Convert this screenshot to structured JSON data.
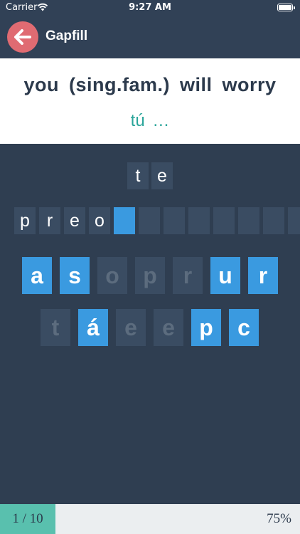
{
  "status": {
    "carrier": "Carrier",
    "time": "9:27 AM"
  },
  "nav": {
    "title": "Gapfill"
  },
  "prompt": {
    "english": "you (sing.fam.) will worry",
    "hint": "tú …"
  },
  "answer_prefix": [
    "t",
    "e"
  ],
  "word_slots": [
    "p",
    "r",
    "e",
    "o",
    "",
    "",
    "",
    "",
    "",
    "",
    "",
    ""
  ],
  "active_slot": 4,
  "keyboard": {
    "row1": [
      {
        "letter": "a",
        "available": true
      },
      {
        "letter": "s",
        "available": true
      },
      {
        "letter": "o",
        "available": false
      },
      {
        "letter": "p",
        "available": false
      },
      {
        "letter": "r",
        "available": false
      },
      {
        "letter": "u",
        "available": true
      },
      {
        "letter": "r",
        "available": true
      }
    ],
    "row2": [
      {
        "letter": "t",
        "available": false
      },
      {
        "letter": "á",
        "available": true
      },
      {
        "letter": "e",
        "available": false
      },
      {
        "letter": "e",
        "available": false
      },
      {
        "letter": "p",
        "available": true
      },
      {
        "letter": "c",
        "available": true
      }
    ]
  },
  "progress": {
    "count_label": "1 / 10",
    "percent_label": "75%",
    "fraction": 0.1
  },
  "colors": {
    "background": "#2f3e51",
    "accent": "#3a9ae0",
    "back": "#e06b72",
    "progress": "#59c0ae",
    "hint": "#2aa59a"
  }
}
